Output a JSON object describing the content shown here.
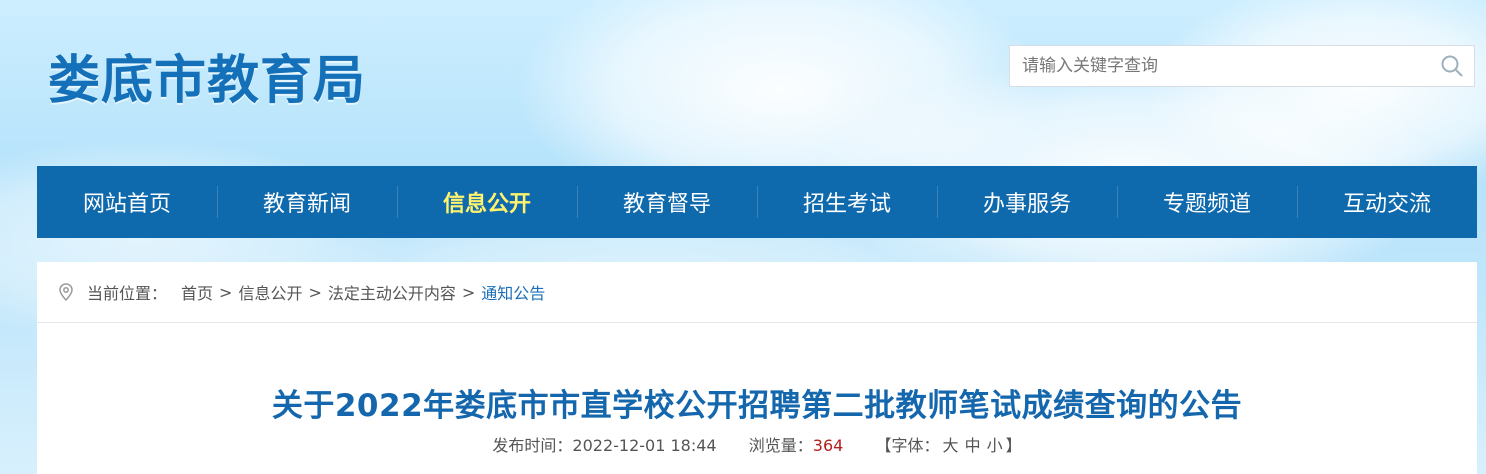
{
  "site": {
    "title": "娄底市教育局"
  },
  "search": {
    "placeholder": "请输入关键字查询",
    "value": "",
    "icon": "search-icon"
  },
  "nav": {
    "items": [
      {
        "label": "网站首页",
        "active": false
      },
      {
        "label": "教育新闻",
        "active": false
      },
      {
        "label": "信息公开",
        "active": true
      },
      {
        "label": "教育督导",
        "active": false
      },
      {
        "label": "招生考试",
        "active": false
      },
      {
        "label": "办事服务",
        "active": false
      },
      {
        "label": "专题频道",
        "active": false
      },
      {
        "label": "互动交流",
        "active": false
      }
    ],
    "bg_color": "#0f69ad",
    "active_color": "#fff36d"
  },
  "breadcrumb": {
    "icon": "location-pin-icon",
    "label": "当前位置：",
    "items": [
      "首页",
      "信息公开",
      "法定主动公开内容",
      "通知公告"
    ],
    "separator": ">"
  },
  "article": {
    "title": "关于2022年娄底市市直学校公开招聘第二批教师笔试成绩查询的公告",
    "publish_label": "发布时间：",
    "publish_time": "2022-12-01 18:44",
    "views_label": "浏览量：",
    "views": "364",
    "font_open": "【字体：",
    "font_large": "大",
    "font_medium": "中",
    "font_small": "小",
    "font_close": "】"
  },
  "colors": {
    "title": "#1467ad",
    "logo": "#1470b8",
    "current_crumb": "#1b6fb8",
    "views": "#b41e1e"
  }
}
